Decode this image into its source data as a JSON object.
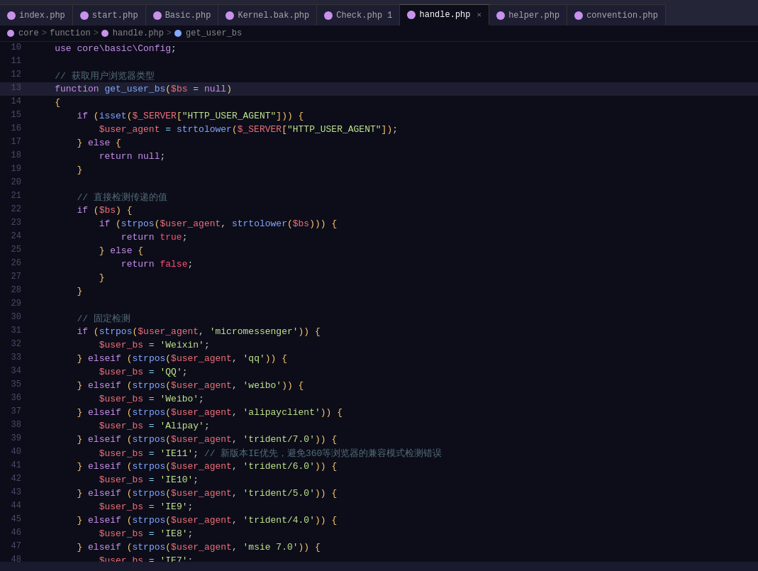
{
  "tabs": [
    {
      "id": "index",
      "label": "index.php",
      "active": false,
      "closable": false
    },
    {
      "id": "start",
      "label": "start.php",
      "active": false,
      "closable": false
    },
    {
      "id": "basic",
      "label": "Basic.php",
      "active": false,
      "closable": false
    },
    {
      "id": "kernel",
      "label": "Kernel.bak.php",
      "active": false,
      "closable": false
    },
    {
      "id": "check",
      "label": "Check.php 1",
      "active": false,
      "closable": false
    },
    {
      "id": "handle",
      "label": "handle.php",
      "active": true,
      "closable": true
    },
    {
      "id": "helper",
      "label": "helper.php",
      "active": false,
      "closable": false
    },
    {
      "id": "convention",
      "label": "convention.php",
      "active": false,
      "closable": false
    }
  ],
  "breadcrumb": {
    "items": [
      "core",
      "function",
      "handle.php",
      "get_user_bs"
    ]
  },
  "editor": {
    "filename": "handle.php"
  }
}
